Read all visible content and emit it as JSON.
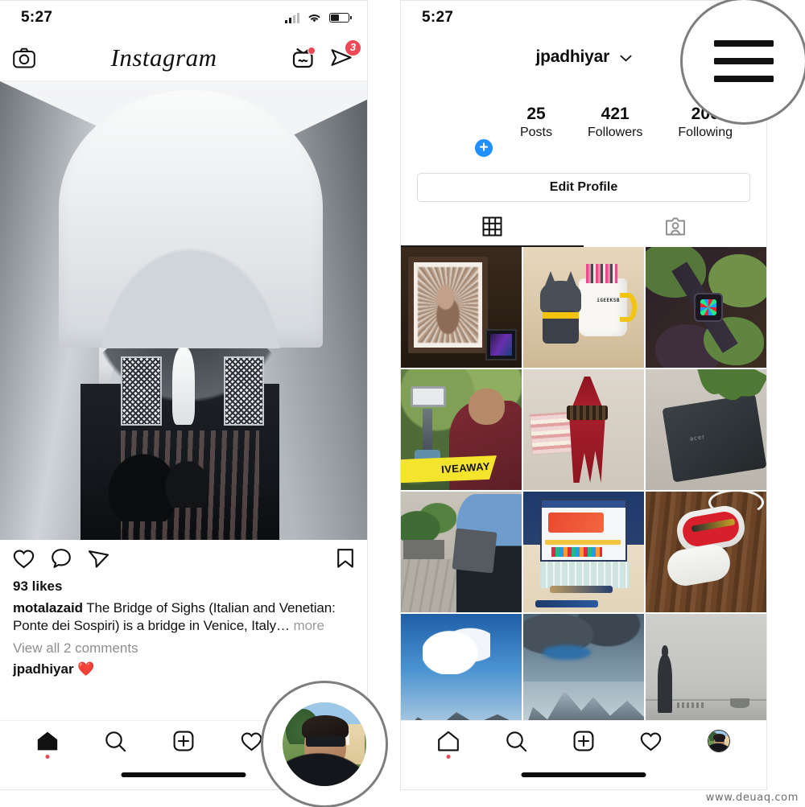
{
  "watermark": "www.deuaq.com",
  "accent": {
    "red": "#ed4956",
    "blue": "#1e90ff",
    "yellow": "#f5e42c",
    "text": "#111111",
    "muted": "#8e8e8e"
  },
  "left_panel": {
    "status": {
      "time": "5:27",
      "signal_icon": "cellular-bars-icon",
      "wifi_icon": "wifi-icon",
      "battery_icon": "battery-icon"
    },
    "header": {
      "camera_icon": "camera-icon",
      "logo_text": "Instagram",
      "igtv_icon": "igtv-icon",
      "igtv_has_dot": true,
      "direct_icon": "direct-paperplane-icon",
      "direct_badge": "3"
    },
    "post": {
      "media_name": "bridge-of-sighs-venice-photo",
      "like_icon": "heart-icon",
      "comment_icon": "comment-bubble-icon",
      "share_icon": "share-paperplane-icon",
      "save_icon": "bookmark-icon",
      "likes_text": "93 likes",
      "caption_author": "motalazaid",
      "caption_text": "The Bridge of Sighs (Italian and Venetian: Ponte dei Sospiri) is a bridge in Venice, Italy…",
      "caption_more": "more",
      "view_comments": "View all 2 comments",
      "comment_author": "jpadhiyar",
      "comment_body": "❤️"
    },
    "tabbar": {
      "home_icon": "home-icon",
      "home_has_dot": true,
      "search_icon": "search-magnifier-icon",
      "add_icon": "add-post-plus-icon",
      "activity_icon": "heart-icon",
      "profile_icon": "profile-avatar-icon"
    },
    "lens": {
      "target": "profile-avatar-icon",
      "label": "magnified-profile-tab"
    }
  },
  "right_panel": {
    "status": {
      "time": "5:27"
    },
    "header": {
      "username": "jpadhiyar",
      "chevron_icon": "chevron-down-icon",
      "menu_icon": "hamburger-menu-icon"
    },
    "profile": {
      "avatar_name": "profile-avatar",
      "add_story_badge": "+",
      "stats": [
        {
          "number": "25",
          "label": "Posts"
        },
        {
          "number": "421",
          "label": "Followers"
        },
        {
          "number": "200",
          "label": "Following"
        }
      ],
      "edit_profile_label": "Edit Profile"
    },
    "tabs": [
      {
        "name": "grid-tab",
        "icon": "grid-icon",
        "active": true
      },
      {
        "name": "tagged-tab",
        "icon": "tagged-person-icon",
        "active": false
      }
    ],
    "grid": [
      {
        "name": "post-thumb-steve-jobs-mosaic",
        "art": "a-jobs"
      },
      {
        "name": "post-thumb-batman-mug",
        "art": "a-bat",
        "overlay_text": "iGEEKSB"
      },
      {
        "name": "post-thumb-apple-watch-on-leaves",
        "art": "a-watch"
      },
      {
        "name": "post-thumb-gimbal-giveaway",
        "art": "a-giveaway",
        "overlay_text": "IVEAWAY"
      },
      {
        "name": "post-thumb-red-tassel",
        "art": "a-tassel"
      },
      {
        "name": "post-thumb-acer-chromebook",
        "art": "a-acer"
      },
      {
        "name": "post-thumb-man-with-tablet-street",
        "art": "a-street"
      },
      {
        "name": "post-thumb-laptop-desk-setup",
        "art": "a-laptop"
      },
      {
        "name": "post-thumb-pen-gift-box",
        "art": "a-pen"
      },
      {
        "name": "post-thumb-clouds-mountain",
        "art": "a-cloud"
      },
      {
        "name": "post-thumb-snow-mountain-range",
        "art": "a-mount"
      },
      {
        "name": "post-thumb-man-at-beach",
        "art": "a-beach"
      }
    ],
    "tabbar": {
      "home_icon": "home-icon",
      "home_has_dot": true,
      "search_icon": "search-magnifier-icon",
      "add_icon": "add-post-plus-icon",
      "activity_icon": "heart-icon",
      "profile_icon": "profile-avatar-icon"
    },
    "lens": {
      "target": "hamburger-menu-icon",
      "label": "magnified-hamburger-menu"
    }
  }
}
